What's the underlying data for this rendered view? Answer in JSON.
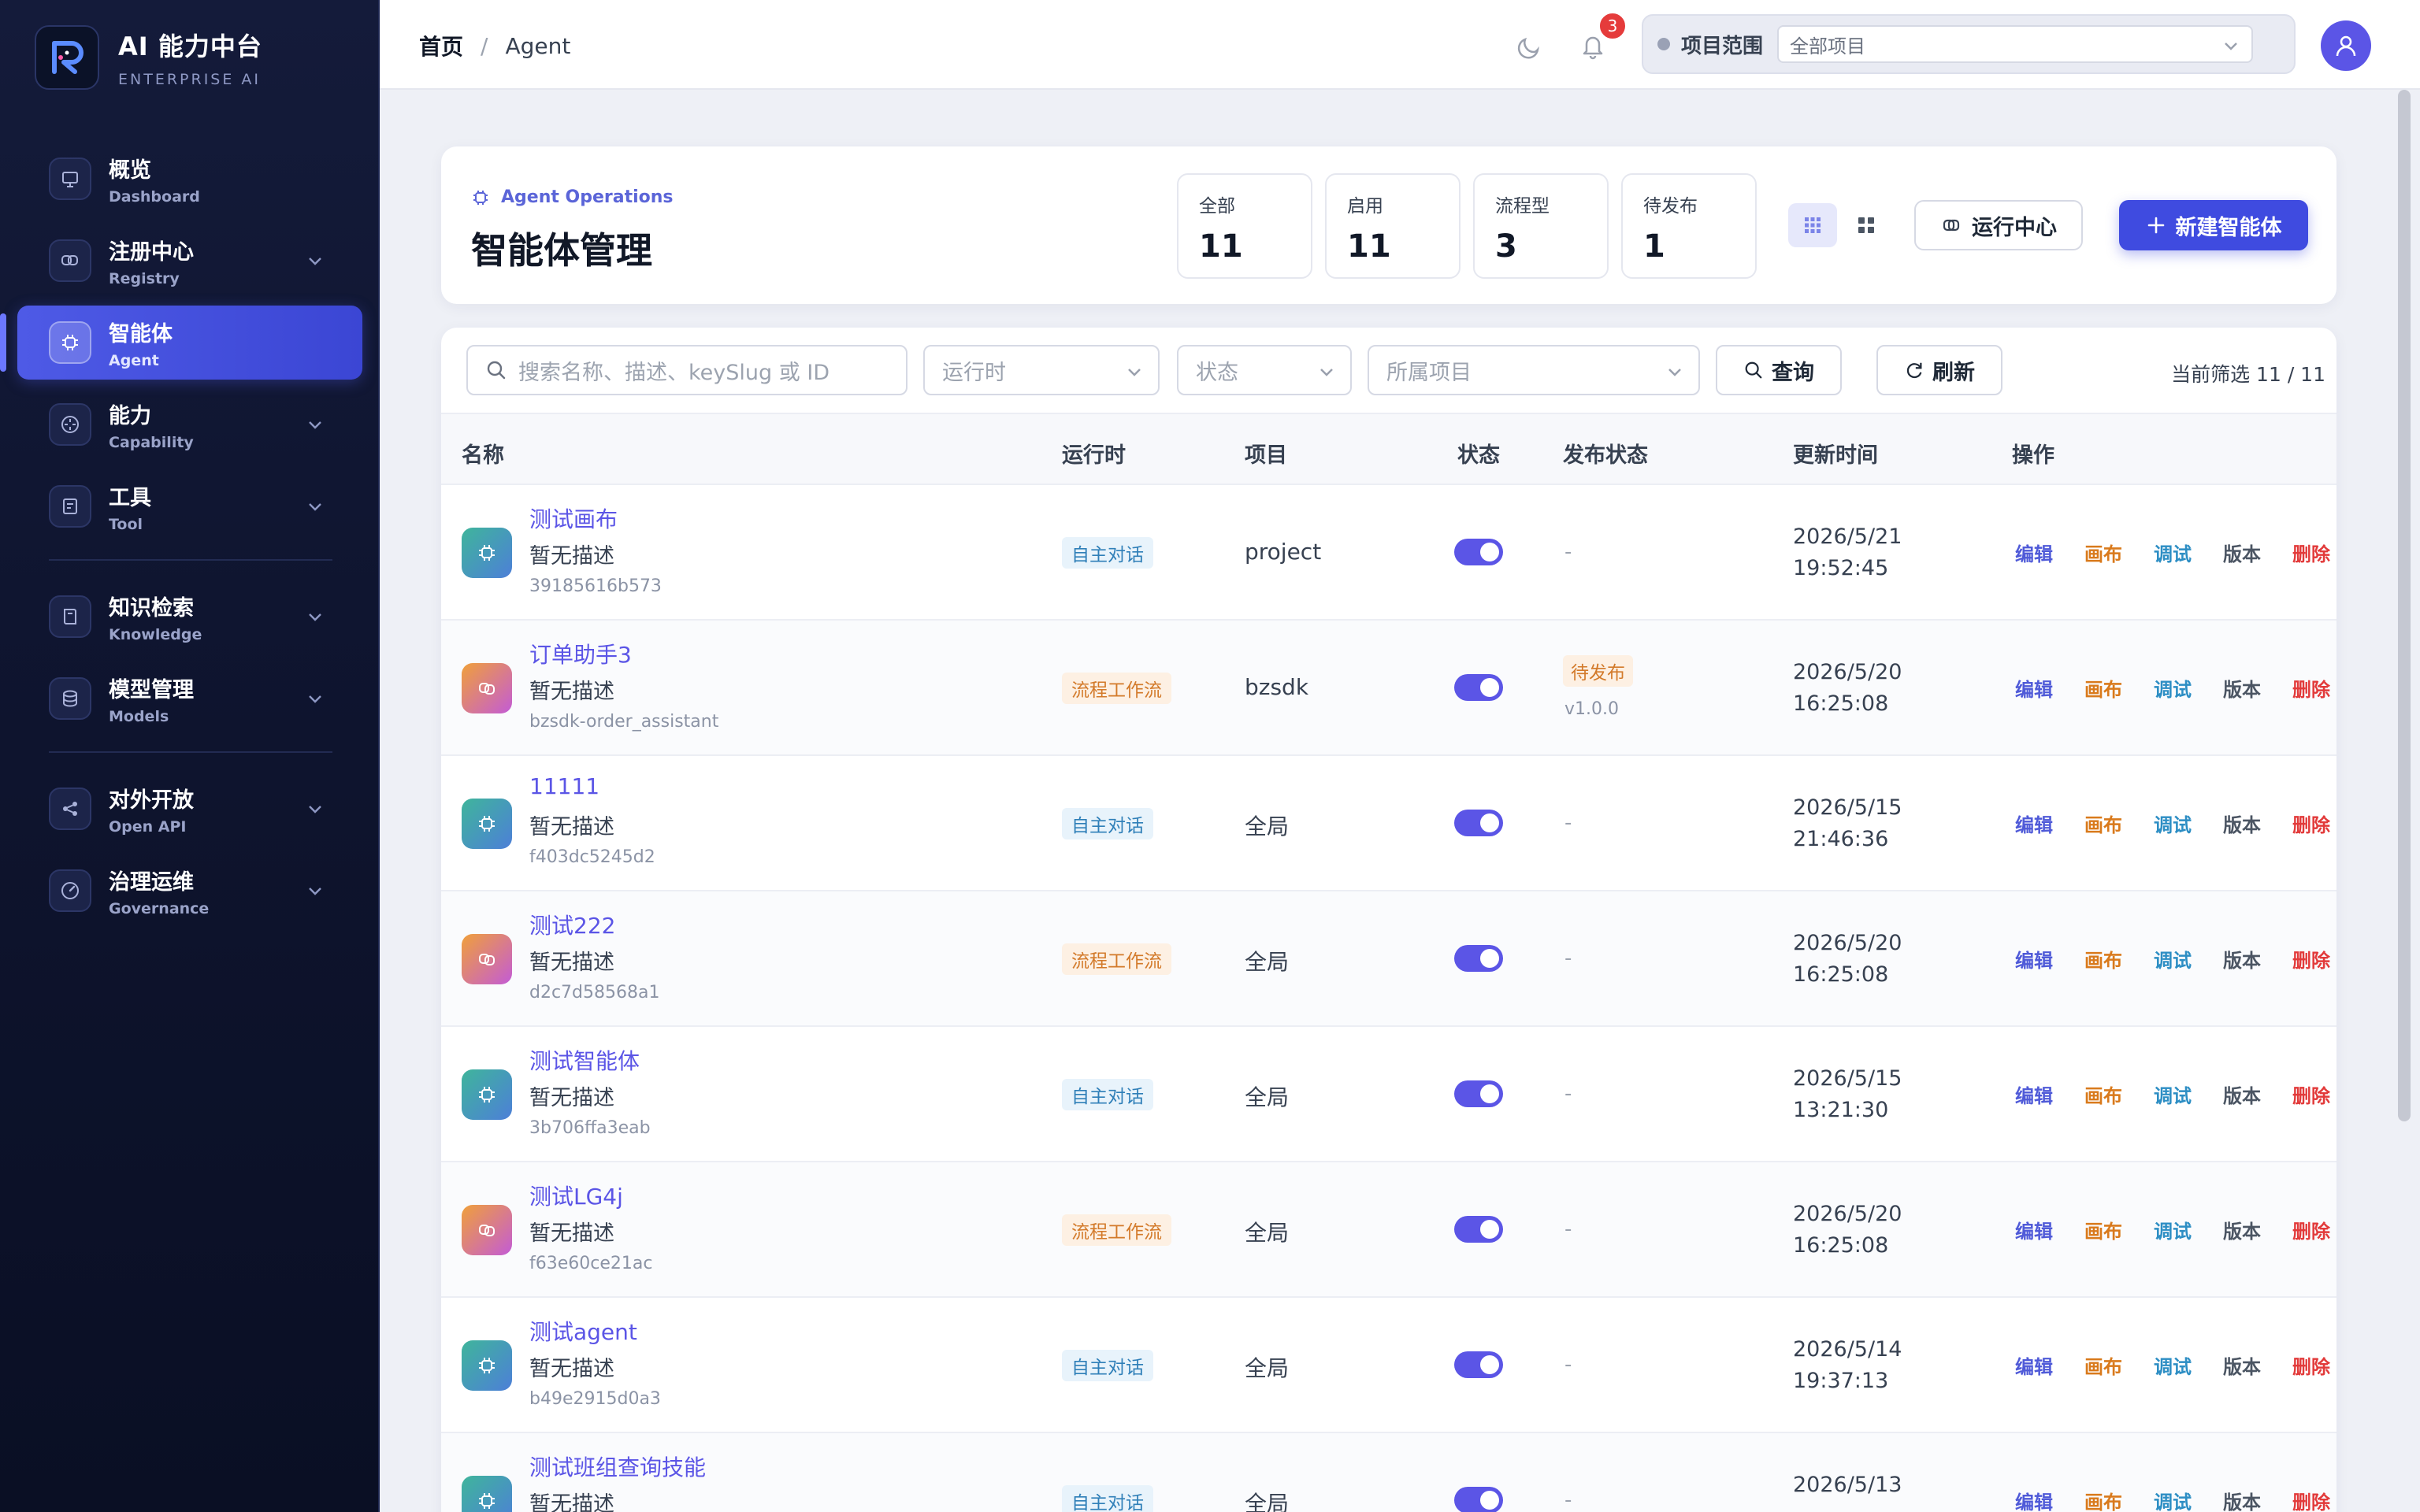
{
  "brand": {
    "title": "AI 能力中台",
    "subtitle": "ENTERPRISE AI"
  },
  "sidebar": {
    "items": [
      {
        "label": "概览",
        "en": "Dashboard",
        "icon": "presentation-icon",
        "expandable": false,
        "active": false
      },
      {
        "label": "注册中心",
        "en": "Registry",
        "icon": "link-icon",
        "expandable": true,
        "active": false
      },
      {
        "label": "智能体",
        "en": "Agent",
        "icon": "chip-icon",
        "expandable": false,
        "active": true
      },
      {
        "label": "能力",
        "en": "Capability",
        "icon": "compass-icon",
        "expandable": true,
        "active": false
      },
      {
        "label": "工具",
        "en": "Tool",
        "icon": "toolbox-icon",
        "expandable": true,
        "active": false
      },
      {
        "label": "知识检索",
        "en": "Knowledge",
        "icon": "book-icon",
        "expandable": true,
        "active": false
      },
      {
        "label": "模型管理",
        "en": "Models",
        "icon": "database-icon",
        "expandable": true,
        "active": false
      },
      {
        "label": "对外开放",
        "en": "Open API",
        "icon": "share-icon",
        "expandable": true,
        "active": false
      },
      {
        "label": "治理运维",
        "en": "Governance",
        "icon": "gauge-icon",
        "expandable": true,
        "active": false
      }
    ]
  },
  "topbar": {
    "breadcrumb_home": "首页",
    "breadcrumb_sep": "/",
    "breadcrumb_current": "Agent",
    "notification_count": "3",
    "scope_label": "项目范围",
    "scope_value": "全部项目"
  },
  "header": {
    "kicker": "Agent Operations",
    "title": "智能体管理",
    "stats": [
      {
        "label": "全部",
        "value": "11"
      },
      {
        "label": "启用",
        "value": "11"
      },
      {
        "label": "流程型",
        "value": "3"
      },
      {
        "label": "待发布",
        "value": "1"
      }
    ],
    "run_center_label": "运行中心",
    "new_agent_label": "新建智能体"
  },
  "filters": {
    "search_placeholder": "搜索名称、描述、keySlug 或 ID",
    "runtime_placeholder": "运行时",
    "status_placeholder": "状态",
    "project_placeholder": "所属项目",
    "query_label": "查询",
    "refresh_label": "刷新",
    "filter_count": "当前筛选 11 / 11"
  },
  "table": {
    "columns": [
      "名称",
      "运行时",
      "项目",
      "状态",
      "发布状态",
      "更新时间",
      "操作"
    ],
    "actions": [
      "编辑",
      "画布",
      "调试",
      "版本",
      "删除"
    ],
    "rows": [
      {
        "name": "测试画布",
        "desc": "暂无描述",
        "slug": "39185616b573",
        "runtime": "自主对话",
        "runtime_type": "chat",
        "project": "project",
        "enabled": true,
        "publish": "-",
        "publish_version": "",
        "time_date": "2026/5/21",
        "time_clock": "19:52:45"
      },
      {
        "name": "订单助手3",
        "desc": "暂无描述",
        "slug": "bzsdk-order_assistant",
        "runtime": "流程工作流",
        "runtime_type": "flow",
        "project": "bzsdk",
        "enabled": true,
        "publish": "待发布",
        "publish_version": "v1.0.0",
        "time_date": "2026/5/20",
        "time_clock": "16:25:08"
      },
      {
        "name": "11111",
        "desc": "暂无描述",
        "slug": "f403dc5245d2",
        "runtime": "自主对话",
        "runtime_type": "chat",
        "project": "全局",
        "enabled": true,
        "publish": "-",
        "publish_version": "",
        "time_date": "2026/5/15",
        "time_clock": "21:46:36"
      },
      {
        "name": "测试222",
        "desc": "暂无描述",
        "slug": "d2c7d58568a1",
        "runtime": "流程工作流",
        "runtime_type": "flow",
        "project": "全局",
        "enabled": true,
        "publish": "-",
        "publish_version": "",
        "time_date": "2026/5/20",
        "time_clock": "16:25:08"
      },
      {
        "name": "测试智能体",
        "desc": "暂无描述",
        "slug": "3b706ffa3eab",
        "runtime": "自主对话",
        "runtime_type": "chat",
        "project": "全局",
        "enabled": true,
        "publish": "-",
        "publish_version": "",
        "time_date": "2026/5/15",
        "time_clock": "13:21:30"
      },
      {
        "name": "测试LG4j",
        "desc": "暂无描述",
        "slug": "f63e60ce21ac",
        "runtime": "流程工作流",
        "runtime_type": "flow",
        "project": "全局",
        "enabled": true,
        "publish": "-",
        "publish_version": "",
        "time_date": "2026/5/20",
        "time_clock": "16:25:08"
      },
      {
        "name": "测试agent",
        "desc": "暂无描述",
        "slug": "b49e2915d0a3",
        "runtime": "自主对话",
        "runtime_type": "chat",
        "project": "全局",
        "enabled": true,
        "publish": "-",
        "publish_version": "",
        "time_date": "2026/5/14",
        "time_clock": "19:37:13"
      },
      {
        "name": "测试班组查询技能",
        "desc": "暂无描述",
        "slug": "",
        "runtime": "自主对话",
        "runtime_type": "chat",
        "project": "全局",
        "enabled": true,
        "publish": "-",
        "publish_version": "",
        "time_date": "2026/5/13",
        "time_clock": ""
      }
    ]
  },
  "colors": {
    "accent": "#3f4be0",
    "sidebar_bg": "#0f1530",
    "danger": "#e23a3a"
  }
}
